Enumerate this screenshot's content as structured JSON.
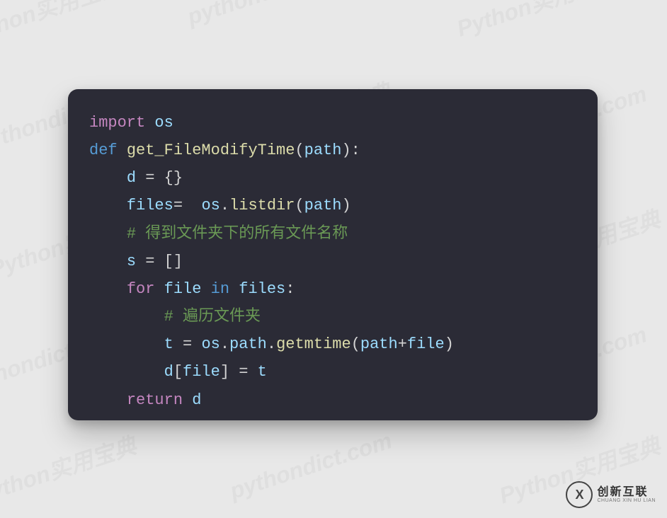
{
  "code": {
    "line1": {
      "kw": "import",
      "mod": "os"
    },
    "line2": {
      "kw": "def",
      "func": "get_FileModifyTime",
      "param": "path"
    },
    "line3": {
      "var": "d",
      "assign": " = {}"
    },
    "line4": {
      "var1": "files",
      "assign": "= ",
      "obj": "os",
      "dot": ".",
      "method": "listdir",
      "arg": "path"
    },
    "line5": {
      "comment": "# 得到文件夹下的所有文件名称"
    },
    "line6": {
      "var": "s",
      "assign": " = []"
    },
    "line7": {
      "kw_for": "for",
      "var": "file",
      "kw_in": "in",
      "iter": "files",
      "colon": ":"
    },
    "line8": {
      "comment": "# 遍历文件夹"
    },
    "line9": {
      "var": "t",
      "eq": " = ",
      "obj": "os",
      "d1": ".",
      "attr": "path",
      "d2": ".",
      "method": "getmtime",
      "lp": "(",
      "arg1": "path",
      "plus": "+",
      "arg2": "file",
      "rp": ")"
    },
    "line10": {
      "var": "d",
      "lb": "[",
      "key": "file",
      "rb": "]",
      "eq": " = ",
      "val": "t"
    },
    "line11": {
      "kw": "return",
      "var": "d"
    }
  },
  "watermark_items": [
    "pythondict.com",
    "Python实用宝典"
  ],
  "logo": {
    "mark": "X",
    "cn": "创新互联",
    "en": "CHUANG XIN HU LIAN"
  }
}
